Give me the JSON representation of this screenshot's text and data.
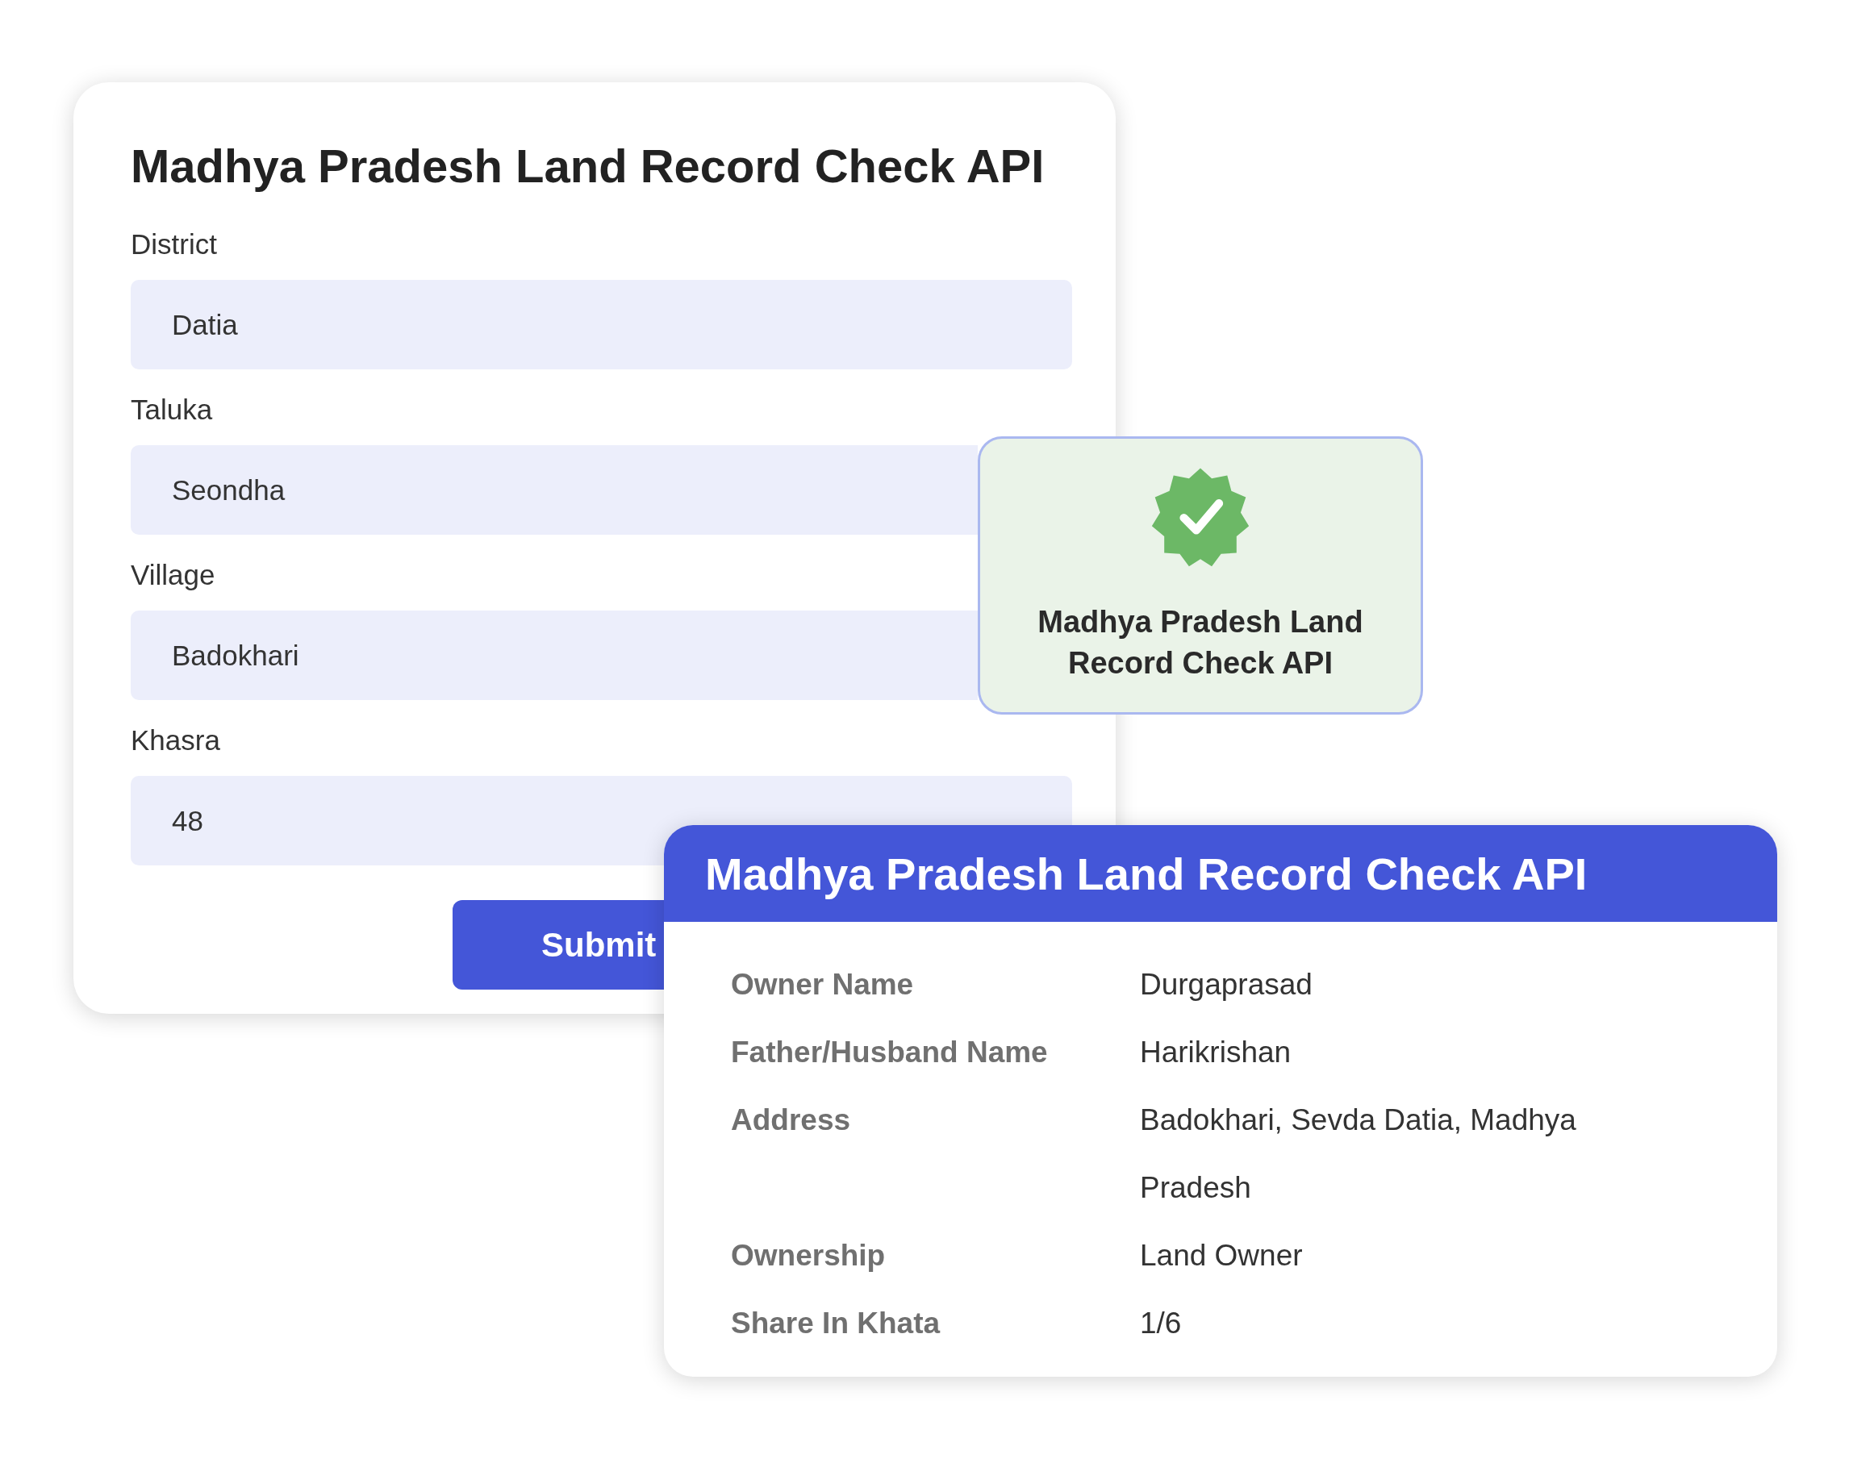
{
  "form": {
    "title": "Madhya Pradesh Land Record Check API",
    "fields": [
      {
        "label": "District",
        "value": "Datia"
      },
      {
        "label": "Taluka",
        "value": "Seondha"
      },
      {
        "label": "Village",
        "value": "Badokhari"
      },
      {
        "label": "Khasra",
        "value": "48"
      }
    ],
    "submit_button": "Submit"
  },
  "verified_badge": {
    "text": "Madhya Pradesh Land Record Check API"
  },
  "result": {
    "title": "Madhya Pradesh Land Record Check API",
    "rows": [
      {
        "label": "Owner Name",
        "value": "Durgaprasad"
      },
      {
        "label": "Father/Husband Name",
        "value": "Harikrishan"
      },
      {
        "label": "Address",
        "value": "Badokhari, Sevda Datia, Madhya Pradesh"
      },
      {
        "label": "Ownership",
        "value": "Land Owner"
      },
      {
        "label": "Share In Khata",
        "value": "1/6"
      }
    ]
  }
}
